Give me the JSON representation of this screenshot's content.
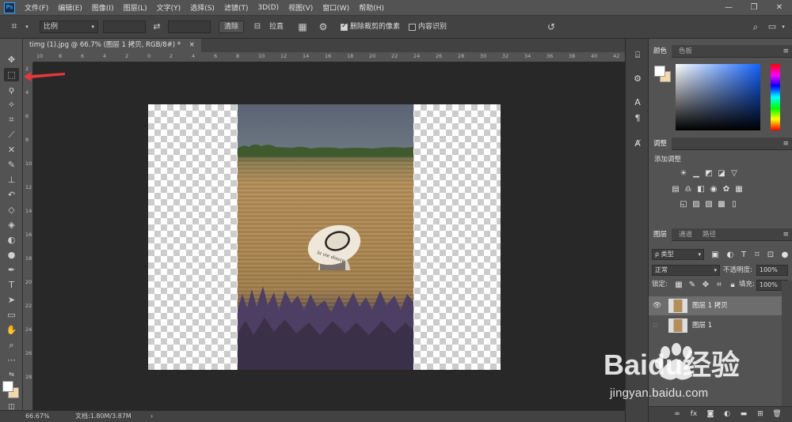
{
  "app": {
    "logo_text": "Ps"
  },
  "menu": {
    "items": [
      {
        "label": "文件(F)"
      },
      {
        "label": "编辑(E)"
      },
      {
        "label": "图像(I)"
      },
      {
        "label": "图层(L)"
      },
      {
        "label": "文字(Y)"
      },
      {
        "label": "选择(S)"
      },
      {
        "label": "滤镜(T)"
      },
      {
        "label": "3D(D)"
      },
      {
        "label": "视图(V)"
      },
      {
        "label": "窗口(W)"
      },
      {
        "label": "帮助(H)"
      }
    ],
    "window_controls": {
      "minimize": "—",
      "restore": "❐",
      "close": "✕"
    }
  },
  "options_bar": {
    "ratio_select": "比例",
    "width_value": "",
    "height_value": "",
    "swap_glyph": "⇄",
    "clear_button": "清除",
    "straighten_button": "拉直",
    "delete_cropped_label": "删除裁剪的像素",
    "delete_cropped_checked": true,
    "content_aware_label": "内容识别",
    "content_aware_checked": false
  },
  "document": {
    "tab_title": "timg (1).jpg @ 66.7% (图层 1 拷贝, RGB/8#) *",
    "tab_close": "×",
    "photo_caption": "la vie douce"
  },
  "ruler": {
    "h_ticks": [
      "10",
      "8",
      "6",
      "4",
      "2",
      "0",
      "2",
      "4",
      "6",
      "8",
      "10",
      "12",
      "14",
      "16",
      "18",
      "20",
      "22",
      "24",
      "26",
      "28",
      "30",
      "32",
      "34",
      "36",
      "38",
      "40",
      "42"
    ],
    "v_ticks": [
      "2",
      "4",
      "6",
      "8",
      "10",
      "12",
      "14",
      "16",
      "18",
      "20",
      "22",
      "24",
      "26",
      "28"
    ]
  },
  "status": {
    "zoom": "66.67%",
    "doc_info": "文档:1.80M/3.87M",
    "arrow": "›"
  },
  "panels": {
    "color": {
      "tabs": [
        "颜色",
        "色板"
      ],
      "fg": "#ffffff",
      "bg": "#f2d8ab"
    },
    "adjustments": {
      "tab": "调整",
      "heading": "添加调整"
    },
    "layers": {
      "tabs": [
        "图层",
        "通道",
        "路径"
      ],
      "filter_kind": "ρ 类型",
      "blend_mode": "正常",
      "opacity_label": "不透明度:",
      "opacity_value": "100%",
      "lock_label": "锁定:",
      "fill_label": "填充:",
      "fill_value": "100%",
      "rows": [
        {
          "name": "图层 1 拷贝",
          "visible": true,
          "selected": true
        },
        {
          "name": "图层 1",
          "visible": false,
          "selected": false
        }
      ],
      "footer_icons": [
        "link-icon",
        "fx-icon",
        "mask-icon",
        "adjustment-icon",
        "folder-icon",
        "new-layer-icon",
        "trash-icon"
      ]
    }
  },
  "watermark": {
    "brand": "Baidu经验",
    "url": "jingyan.baidu.com"
  },
  "colors": {
    "bg": "#535353",
    "panel_dark": "#424242",
    "canvas": "#282828",
    "accent_red": "#e8373a"
  }
}
